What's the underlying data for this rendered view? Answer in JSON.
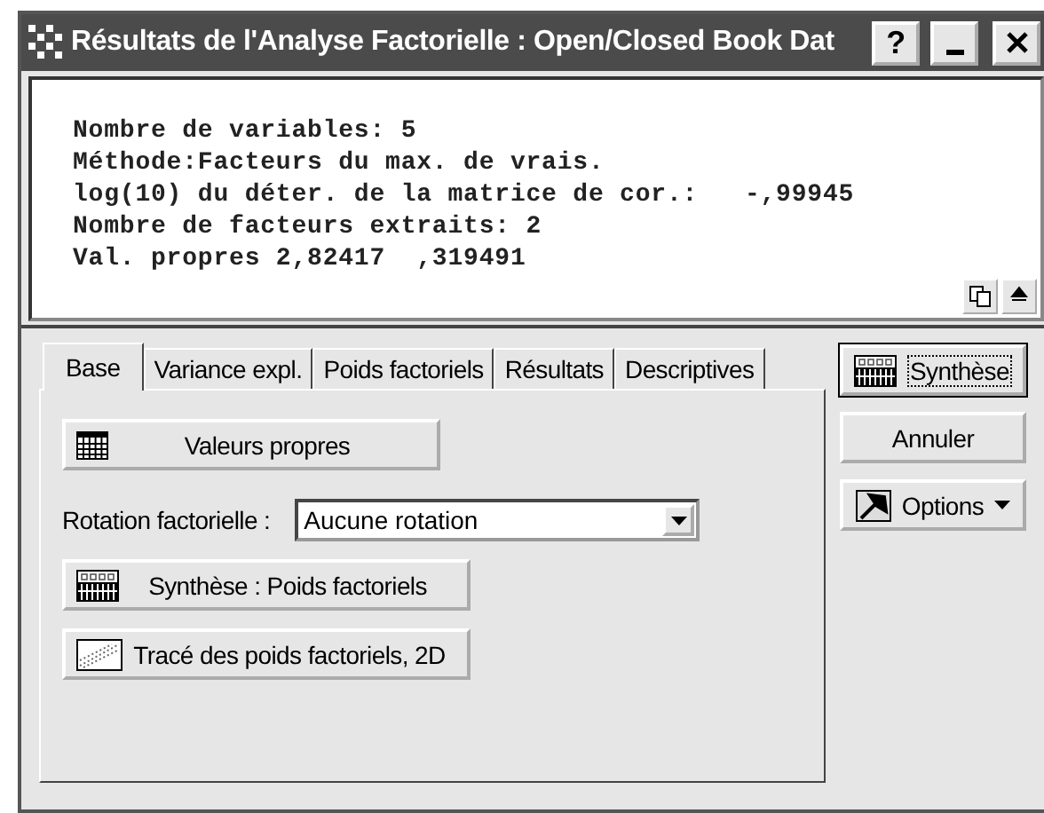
{
  "window": {
    "title": "Résultats de l'Analyse Factorielle : Open/Closed Book Dat",
    "help_button": "?"
  },
  "output": {
    "lines": [
      "Nombre de variables: 5",
      "Méthode:Facteurs du max. de vrais.",
      "log(10) du déter. de la matrice de cor.:   -,99945",
      "Nombre de facteurs extraits: 2",
      "Val. propres 2,82417  ,319491"
    ]
  },
  "tabs": [
    {
      "label": "Base",
      "selected": true
    },
    {
      "label": "Variance expl.",
      "selected": false
    },
    {
      "label": "Poids factoriels",
      "selected": false
    },
    {
      "label": "Résultats",
      "selected": false
    },
    {
      "label": "Descriptives",
      "selected": false
    }
  ],
  "base_panel": {
    "eigen_button": {
      "label": "Valeurs propres",
      "kind": "table"
    },
    "rotation": {
      "label": "Rotation factorielle :",
      "value": "Aucune rotation"
    },
    "buttons": [
      {
        "label": "Synthèse : Poids factoriels",
        "kind": "summary"
      },
      {
        "label": "Tracé des poids factoriels, 2D",
        "kind": "plot"
      }
    ]
  },
  "side_buttons": [
    {
      "label": "Synthèse",
      "kind": "summary",
      "default": true,
      "menu": false
    },
    {
      "label": "Annuler",
      "kind": "plain",
      "default": false,
      "menu": false
    },
    {
      "label": "Options",
      "kind": "options",
      "default": false,
      "menu": true
    }
  ]
}
